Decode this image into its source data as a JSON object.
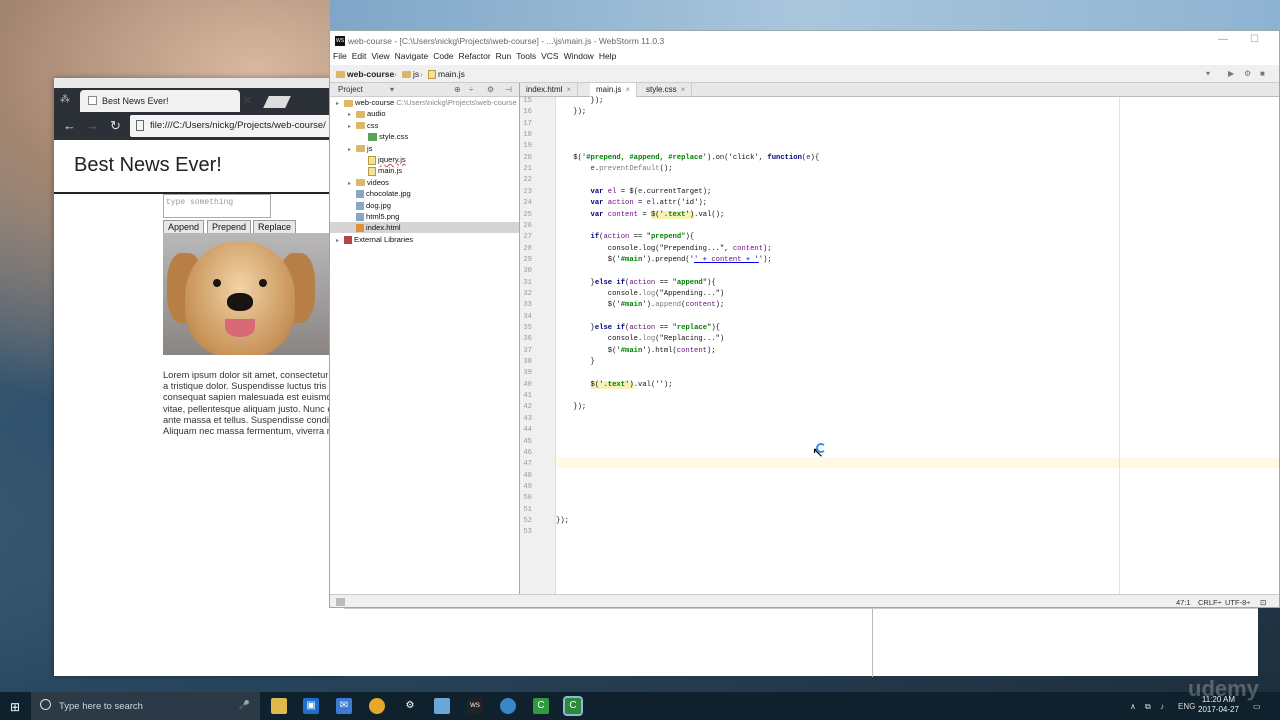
{
  "chrome": {
    "tab_title": "Best News Ever!",
    "url": "file:///C:/Users/nickg/Projects/web-course/",
    "page_heading": "Best News Ever!",
    "textarea_placeholder": "type something",
    "buttons": [
      "Append",
      "Prepend",
      "Replace"
    ],
    "lorem_lines": [
      "Lorem ipsum dolor sit amet, consectetur",
      "a tristique dolor. Suspendisse luctus tris",
      "consequat sapien malesuada est euismo",
      "vitae, pellentesque aliquam justo. Nunc e",
      "ante massa et tellus. Suspendisse condi",
      "Aliquam nec massa fermentum, viverra n"
    ]
  },
  "ide": {
    "title": "web-course - [C:\\Users\\nickg\\Projects\\web-course] - ...\\js\\main.js - WebStorm 11.0.3",
    "menu": [
      "File",
      "Edit",
      "View",
      "Navigate",
      "Code",
      "Refactor",
      "Run",
      "Tools",
      "VCS",
      "Window",
      "Help"
    ],
    "breadcrumb": [
      "web-course",
      "js",
      "main.js"
    ],
    "project_label": "Project",
    "tree": [
      {
        "label": "web-course",
        "path": "C:\\Users\\nickg\\Projects\\web-course",
        "indent": 0,
        "kind": "folder"
      },
      {
        "label": "audio",
        "indent": 1,
        "kind": "folder"
      },
      {
        "label": "css",
        "indent": 1,
        "kind": "folder"
      },
      {
        "label": "style.css",
        "indent": 2,
        "kind": "css"
      },
      {
        "label": "js",
        "indent": 1,
        "kind": "folder"
      },
      {
        "label": "jquery.js",
        "indent": 2,
        "kind": "js"
      },
      {
        "label": "main.js",
        "indent": 2,
        "kind": "js"
      },
      {
        "label": "videos",
        "indent": 1,
        "kind": "folder"
      },
      {
        "label": "chocolate.jpg",
        "indent": 1,
        "kind": "img"
      },
      {
        "label": "dog.jpg",
        "indent": 1,
        "kind": "img"
      },
      {
        "label": "html5.png",
        "indent": 1,
        "kind": "img"
      },
      {
        "label": "index.html",
        "indent": 1,
        "kind": "html",
        "selected": true
      },
      {
        "label": "External Libraries",
        "indent": 0,
        "kind": "lib"
      }
    ],
    "tabs": [
      {
        "label": "index.html",
        "active": false
      },
      {
        "label": "main.js",
        "active": true
      },
      {
        "label": "style.css",
        "active": false
      }
    ],
    "code_lines": [
      {
        "n": "15",
        "html": "        });"
      },
      {
        "n": "16",
        "html": "    });"
      },
      {
        "n": "17",
        "html": ""
      },
      {
        "n": "18",
        "html": ""
      },
      {
        "n": "19",
        "html": ""
      },
      {
        "n": "20",
        "html": "    $('<span class=\"str\">#prepend, #append, #replace</span>').on('click', <span class=\"kw\">function</span>(<span class=\"var\">e</span>){"
      },
      {
        "n": "21",
        "html": "        <span class=\"var\">e</span>.<span class=\"fn\">preventDefault</span>();"
      },
      {
        "n": "22",
        "html": ""
      },
      {
        "n": "23",
        "html": "        <span class=\"kw\">var</span> <span class=\"var\">el</span> = $(<span class=\"var\">e</span>.currentTarget);"
      },
      {
        "n": "24",
        "html": "        <span class=\"kw\">var</span> <span class=\"var\">action</span> = <span class=\"var\">el</span>.attr('id');"
      },
      {
        "n": "25",
        "html": "        <span class=\"kw\">var</span> <span class=\"var\">content</span> = <span class=\"hl\">$('<span class=\"str\">.text</span>')</span>.val();"
      },
      {
        "n": "26",
        "html": ""
      },
      {
        "n": "27",
        "html": "        <span class=\"kw\">if</span>(<span class=\"var\">action</span> == <span class=\"str\">\"prepend\"</span>){"
      },
      {
        "n": "28",
        "html": "            console.log(\"Prepending...\", <span class=\"var\">content</span>);"
      },
      {
        "n": "29",
        "html": "            $('<span class=\"str\">#main</span>').prepend('<a href=\"#\">' + <span class=\"var\">content</span> + '</a>');"
      },
      {
        "n": "30",
        "html": ""
      },
      {
        "n": "31",
        "html": "        }<span class=\"kw\">else if</span>(<span class=\"var\">action</span> == <span class=\"str\">\"append\"</span>){"
      },
      {
        "n": "32",
        "html": "            console.<span class=\"fn\">log</span>(\"Appending...\")"
      },
      {
        "n": "33",
        "html": "            $('<span class=\"str\">#main</span>').<span class=\"fn\">append</span>(<span class=\"var\">content</span>);"
      },
      {
        "n": "34",
        "html": ""
      },
      {
        "n": "35",
        "html": "        }<span class=\"kw\">else if</span>(<span class=\"var\">action</span> == <span class=\"str\">\"replace\"</span>){"
      },
      {
        "n": "36",
        "html": "            console.<span class=\"fn\">log</span>(\"Replacing...\")"
      },
      {
        "n": "37",
        "html": "            $('<span class=\"str\">#main</span>').html(<span class=\"var\">content</span>);"
      },
      {
        "n": "38",
        "html": "        }"
      },
      {
        "n": "39",
        "html": ""
      },
      {
        "n": "40",
        "html": "        <span class=\"hl\">$('<span class=\"str\">.text</span>')</span>.val('');"
      },
      {
        "n": "41",
        "html": ""
      },
      {
        "n": "42",
        "html": "    });"
      },
      {
        "n": "43",
        "html": ""
      },
      {
        "n": "44",
        "html": ""
      },
      {
        "n": "45",
        "html": ""
      },
      {
        "n": "46",
        "html": ""
      },
      {
        "n": "47",
        "html": ""
      },
      {
        "n": "48",
        "html": ""
      },
      {
        "n": "49",
        "html": ""
      },
      {
        "n": "50",
        "html": ""
      },
      {
        "n": "51",
        "html": ""
      },
      {
        "n": "52",
        "html": "});"
      },
      {
        "n": "53",
        "html": ""
      }
    ],
    "status": {
      "position": "47:1",
      "line_sep": "CRLF÷",
      "encoding": "UTF-8÷"
    }
  },
  "taskbar": {
    "search_placeholder": "Type here to search",
    "lang": "ENG",
    "time": "11:20 AM",
    "date": "2017-04-27"
  },
  "watermark": "udemy"
}
